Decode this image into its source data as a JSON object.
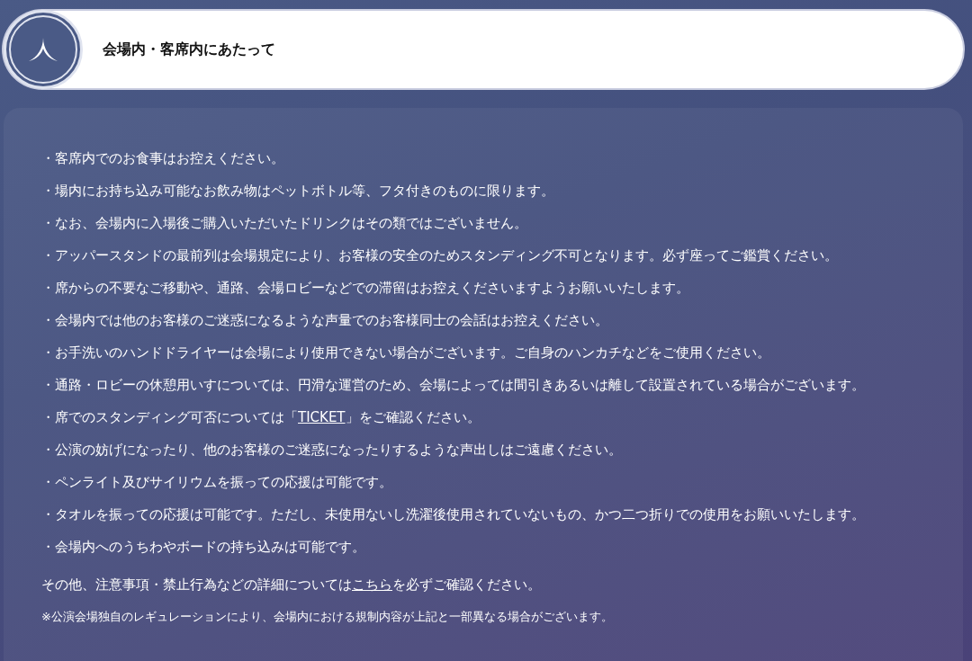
{
  "header": {
    "title": "会場内・客席内にあたって"
  },
  "rules": [
    {
      "text": "・客席内でのお食事はお控えください。"
    },
    {
      "text": "・場内にお持ち込み可能なお飲み物はペットボトル等、フタ付きのものに限ります。"
    },
    {
      "text": "・なお、会場内に入場後ご購入いただいたドリンクはその類ではございません。"
    },
    {
      "text": "・アッパースタンドの最前列は会場規定により、お客様の安全のためスタンディング不可となります。必ず座ってご鑑賞ください。"
    },
    {
      "text": "・席からの不要なご移動や、通路、会場ロビーなどでの滞留はお控えくださいますようお願いいたします。"
    },
    {
      "text": "・会場内では他のお客様のご迷惑になるような声量でのお客様同士の会話はお控えください。"
    },
    {
      "text": "・お手洗いのハンドドライヤーは会場により使用できない場合がございます。ご自身のハンカチなどをご使用ください。"
    },
    {
      "text": "・通路・ロビーの休憩用いすについては、円滑な運営のため、会場によっては間引きあるいは離して設置されている場合がございます。"
    },
    {
      "text": "・席でのスタンディング可否については「",
      "link": "TICKET",
      "after": "」をご確認ください。"
    },
    {
      "text": "・公演の妨げになったり、他のお客様のご迷惑になったりするような声出しはご遠慮ください。"
    },
    {
      "text": "・ペンライト及びサイリウムを振っての応援は可能です。"
    },
    {
      "text": "・タオルを振っての応援は可能です。ただし、未使用ないし洗濯後使用されていないもの、かつ二つ折りでの使用をお願いいたします。"
    },
    {
      "text": "・会場内へのうちわやボードの持ち込みは可能です。"
    }
  ],
  "details": {
    "text": "その他、注意事項・禁止行為などの詳細については",
    "link": "こちら",
    "after": "を必ずご確認ください。"
  },
  "note": "※公演会場独自のレギュレーションにより、会場内における規制内容が上記と一部異なる場合がございます。"
}
